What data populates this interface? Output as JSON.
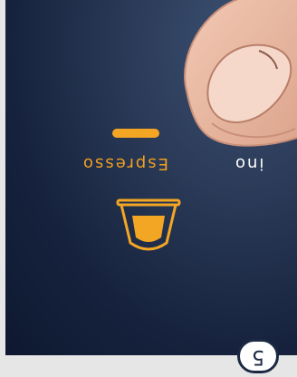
{
  "menu": {
    "selected_label": "Espresso",
    "next_label": "ino",
    "selected_icon": "espresso-cup-icon"
  },
  "step": {
    "number": "5"
  },
  "colors": {
    "accent": "#f3a624",
    "background": "#16223d",
    "text": "#ffffff"
  }
}
